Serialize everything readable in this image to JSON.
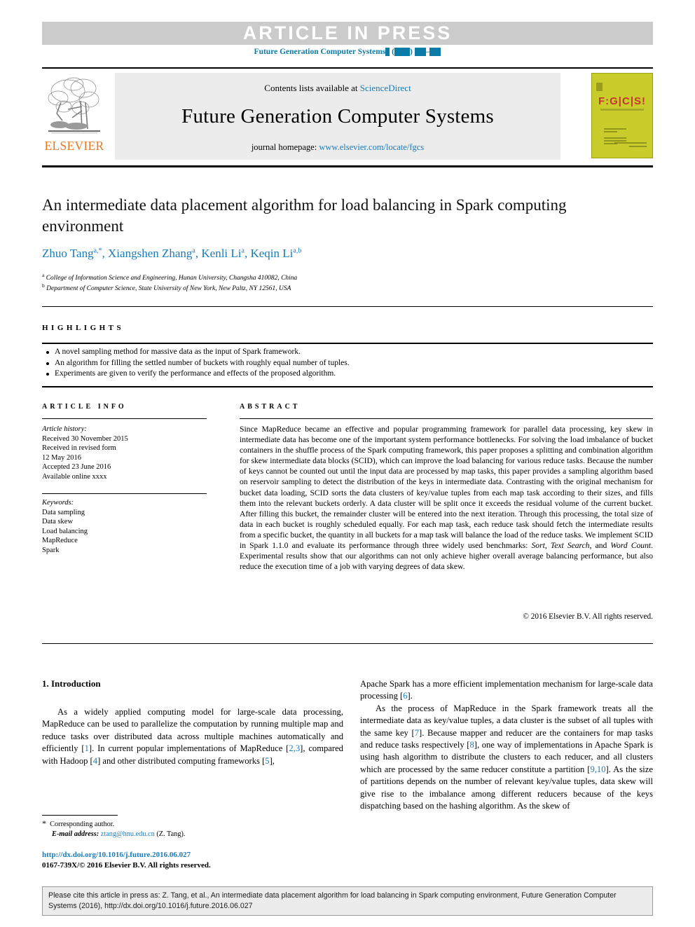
{
  "banner": {
    "article_in_press": "ARTICLE IN PRESS",
    "journal_ref_prefix": "Future Generation Computer Systems"
  },
  "masthead": {
    "contents_prefix": "Contents lists available at ",
    "contents_link": "ScienceDirect",
    "journal_title": "Future Generation Computer Systems",
    "homepage_prefix": "journal homepage: ",
    "homepage_link": "www.elsevier.com/locate/fgcs",
    "publisher": "ELSEVIER",
    "cover_logo_text": "F:G|C|S!"
  },
  "article": {
    "title": "An intermediate data placement algorithm for load balancing in Spark computing environment",
    "authors_html": "Zhuo Tang<sup>a,*</sup>, Xiangshen Zhang<sup>a</sup>, Kenli Li<sup>a</sup>, Keqin Li<sup>a,b</sup>",
    "affiliation_a": "College of Information Science and Engineering, Hunan University, Changsha 410082, China",
    "affiliation_b": "Department of Computer Science, State University of New York, New Paltz, NY 12561, USA"
  },
  "highlights": {
    "heading": "HIGHLIGHTS",
    "items": [
      "A novel sampling method for massive data as the input of Spark framework.",
      "An algorithm for filling the settled number of buckets with roughly equal number of tuples.",
      "Experiments are given to verify the performance and effects of the proposed algorithm."
    ]
  },
  "article_info": {
    "heading": "ARTICLE INFO",
    "history_label": "Article history:",
    "history_lines": [
      "Received 30 November 2015",
      "Received in revised form",
      "12 May 2016",
      "Accepted 23 June 2016",
      "Available online xxxx"
    ],
    "keywords_label": "Keywords:",
    "keywords": [
      "Data sampling",
      "Data skew",
      "Load balancing",
      "MapReduce",
      "Spark"
    ]
  },
  "abstract": {
    "heading": "ABSTRACT",
    "text_part1": "Since MapReduce became an effective and popular programming framework for parallel data processing, key skew in intermediate data has become one of the important system performance bottlenecks. For solving the load imbalance of bucket containers in the shuffle process of the Spark computing framework, this paper proposes a splitting and combination algorithm for skew intermediate data blocks (SCID), which can improve the load balancing for various reduce tasks. Because the number of keys cannot be counted out until the input data are processed by map tasks, this paper provides a sampling algorithm based on reservoir sampling to detect the distribution of the keys in intermediate data. Contrasting with the original mechanism for bucket data loading, SCID sorts the data clusters of key/value tuples from each map task according to their sizes, and fills them into the relevant buckets orderly. A data cluster will be split once it exceeds the residual volume of the current bucket. After filling this bucket, the remainder cluster will be entered into the next iteration. Through this processing, the total size of data in each bucket is roughly scheduled equally. For each map task, each reduce task should fetch the intermediate results from a specific bucket, the quantity in all buckets for a map task will balance the load of the reduce tasks. We implement SCID in Spark 1.1.0 and evaluate its performance through three widely used benchmarks: ",
    "benchmark1": "Sort",
    "mid1": ", ",
    "benchmark2": "Text Search",
    "mid2": ", and ",
    "benchmark3": "Word Count",
    "text_part2": ". Experimental results show that our algorithms can not only achieve higher overall average balancing performance, but also reduce the execution time of a job with varying degrees of data skew.",
    "copyright": "© 2016 Elsevier B.V. All rights reserved."
  },
  "body": {
    "section_heading": "1. Introduction",
    "left_para": "As a widely applied computing model for large-scale data processing, MapReduce can be used to parallelize the computation by running multiple map and reduce tasks over distributed data across multiple machines automatically and efficiently [1]. In current popular implementations of MapReduce [2,3], compared with Hadoop [4] and other distributed computing frameworks [5],",
    "right_para1": "Apache Spark has a more efficient implementation mechanism for large-scale data processing [6].",
    "right_para2": "As the process of MapReduce in the Spark framework treats all the intermediate data as key/value tuples, a data cluster is the subset of all tuples with the same key [7]. Because mapper and reducer are the containers for map tasks and reduce tasks respectively [8], one way of implementations in Apache Spark is using hash algorithm to distribute the clusters to each reducer, and all clusters which are processed by the same reducer constitute a partition [9,10]. As the size of partitions depends on the number of relevant key/value tuples, data skew will give rise to the imbalance among different reducers because of the keys dispatching based on the hashing algorithm. As the skew of"
  },
  "footer": {
    "corresponding_author": "Corresponding author.",
    "email_label": "E-mail address:",
    "email": "ztang@hnu.edu.cn",
    "email_suffix": "(Z. Tang).",
    "doi_url": "http://dx.doi.org/10.1016/j.future.2016.06.027",
    "issn_line": "0167-739X/© 2016 Elsevier B.V. All rights reserved.",
    "citation": "Please cite this article in press as: Z. Tang, et al., An intermediate data placement algorithm for load balancing in Spark computing environment, Future Generation Computer Systems (2016), http://dx.doi.org/10.1016/j.future.2016.06.027"
  },
  "colors": {
    "link_blue": "#1a7bb9",
    "journal_blue": "#0b7ba8",
    "elsevier_orange": "#e87722",
    "banner_gray": "#cbcbcb",
    "cover_yellow": "#c9cc2b"
  }
}
